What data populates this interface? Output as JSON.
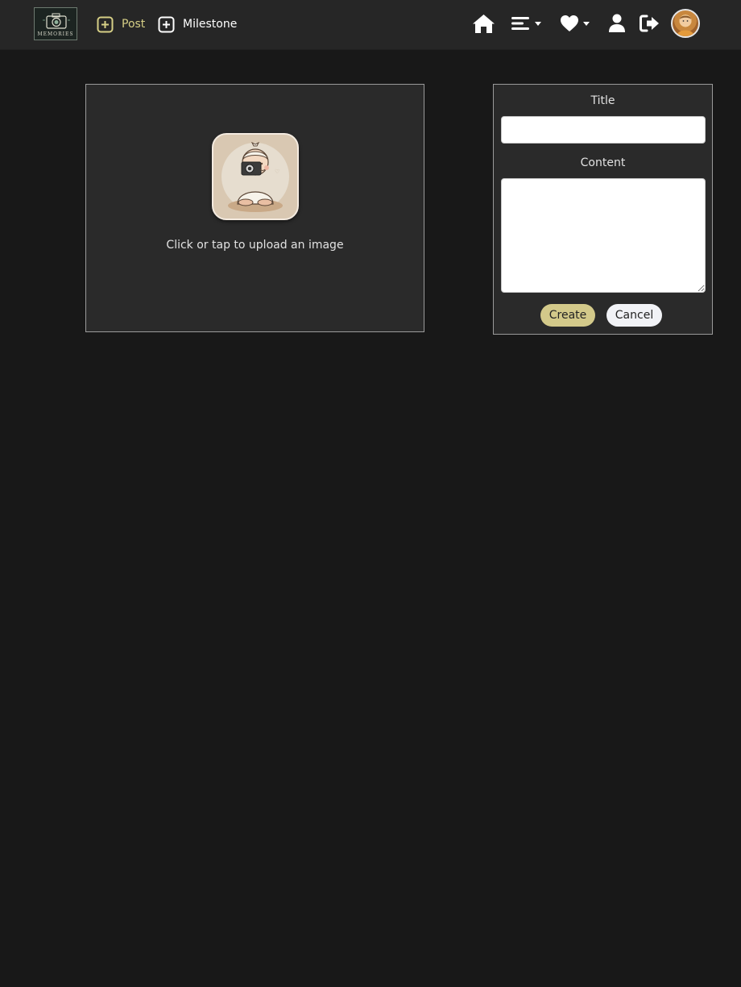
{
  "nav": {
    "logo_text": "MEMORIES",
    "post_label": "Post",
    "milestone_label": "Milestone",
    "icons": [
      "home-icon",
      "menu-icon",
      "heart-icon",
      "user-icon",
      "logout-icon"
    ]
  },
  "upload": {
    "prompt": "Click or tap to upload an image"
  },
  "form": {
    "title_label": "Title",
    "title_value": "",
    "content_label": "Content",
    "content_value": "",
    "create_label": "Create",
    "cancel_label": "Cancel"
  },
  "colors": {
    "background": "#181818",
    "navbar": "#262626",
    "accent": "#d3c98a",
    "panel": "#2a2a2a"
  }
}
